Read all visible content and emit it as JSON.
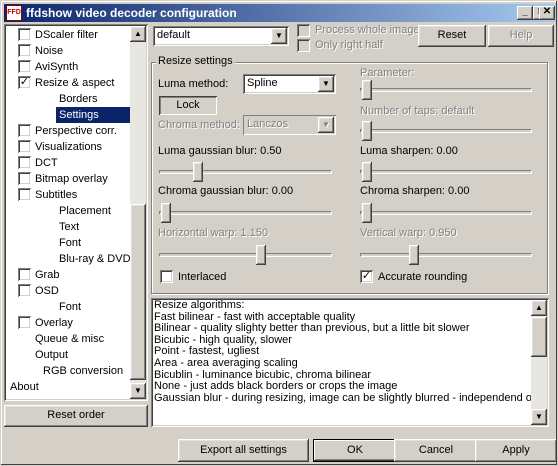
{
  "window": {
    "title": "ffdshow video decoder configuration",
    "icon_text": "FFD"
  },
  "titlebar_buttons": {
    "minimize": "_",
    "maximize": "□",
    "close": "✕"
  },
  "tree": {
    "items": [
      {
        "label": "DScaler filter",
        "check": "unchecked",
        "indent": 1
      },
      {
        "label": "Noise",
        "check": "unchecked",
        "indent": 1
      },
      {
        "label": "AviSynth",
        "check": "unchecked",
        "indent": 1
      },
      {
        "label": "Resize & aspect",
        "check": "checked",
        "indent": 1
      },
      {
        "label": "Borders",
        "check": "none",
        "indent": 2
      },
      {
        "label": "Settings",
        "check": "none",
        "indent": 2,
        "selected": true
      },
      {
        "label": "Perspective corr.",
        "check": "unchecked",
        "indent": 1
      },
      {
        "label": "Visualizations",
        "check": "unchecked",
        "indent": 1
      },
      {
        "label": "DCT",
        "check": "unchecked",
        "indent": 1
      },
      {
        "label": "Bitmap overlay",
        "check": "unchecked",
        "indent": 1
      },
      {
        "label": "Subtitles",
        "check": "unchecked",
        "indent": 1
      },
      {
        "label": "Placement",
        "check": "none",
        "indent": 2
      },
      {
        "label": "Text",
        "check": "none",
        "indent": 2
      },
      {
        "label": "Font",
        "check": "none",
        "indent": 2
      },
      {
        "label": "Blu-ray & DVD",
        "check": "none",
        "indent": 2
      },
      {
        "label": "Grab",
        "check": "unchecked",
        "indent": 1
      },
      {
        "label": "OSD",
        "check": "unchecked",
        "indent": 1
      },
      {
        "label": "Font",
        "check": "none",
        "indent": 2
      },
      {
        "label": "Overlay",
        "check": "unchecked",
        "indent": 1
      },
      {
        "label": "Queue & misc",
        "check": "none",
        "indent": 1
      },
      {
        "label": "Output",
        "check": "none",
        "indent": 1
      },
      {
        "label": "RGB conversion",
        "check": "none",
        "indent": 3
      },
      {
        "label": "About",
        "check": "none",
        "indent": 0
      }
    ]
  },
  "reset_order_label": "Reset order",
  "top": {
    "preset": "default",
    "process_whole_image": "Process whole image",
    "only_right_half": "Only right half",
    "reset_label": "Reset",
    "help_label": "Help"
  },
  "resize": {
    "group_title": "Resize settings",
    "luma_method_label": "Luma method:",
    "luma_method_value": "Spline",
    "lock_label": "Lock",
    "chroma_method_label": "Chroma method:",
    "chroma_method_value": "Lanczos",
    "parameter_label": "Parameter:",
    "taps_label": "Number of taps: default",
    "luma_blur_label": "Luma gaussian blur: 0.50",
    "luma_sharpen_label": "Luma sharpen: 0.00",
    "chroma_blur_label": "Chroma gaussian blur: 0.00",
    "chroma_sharpen_label": "Chroma sharpen: 0.00",
    "hwarp_label": "Horizontal warp: 1.150",
    "vwarp_label": "Vertical warp: 0.950",
    "interlaced_label": "Interlaced",
    "interlaced_checked": false,
    "accurate_label": "Accurate rounding",
    "accurate_checked": true,
    "slider_levels": {
      "parameter": 0.0,
      "taps": 0.0,
      "luma_blur": 0.2,
      "luma_sharpen": 0.0,
      "chroma_blur": 0.0,
      "chroma_sharpen": 0.0,
      "hwarp": 0.6,
      "vwarp": 0.3
    }
  },
  "memo": {
    "lines": [
      "Resize algorithms:",
      " Fast bilinear - fast with acceptable quality",
      " Bilinear - quality slighty better than previous, but a little bit slower",
      " Bicubic - high quality, slower",
      " Point - fastest, ugliest",
      " Area - area averaging scaling",
      " Bicublin - luminance bicubic, chroma bilinear",
      " None - just adds black borders or crops the image",
      "Gaussian blur - during resizing, image can be slightly blurred - independend on"
    ]
  },
  "bottom": {
    "export_label": "Export all settings",
    "ok_label": "OK",
    "cancel_label": "Cancel",
    "apply_label": "Apply"
  }
}
